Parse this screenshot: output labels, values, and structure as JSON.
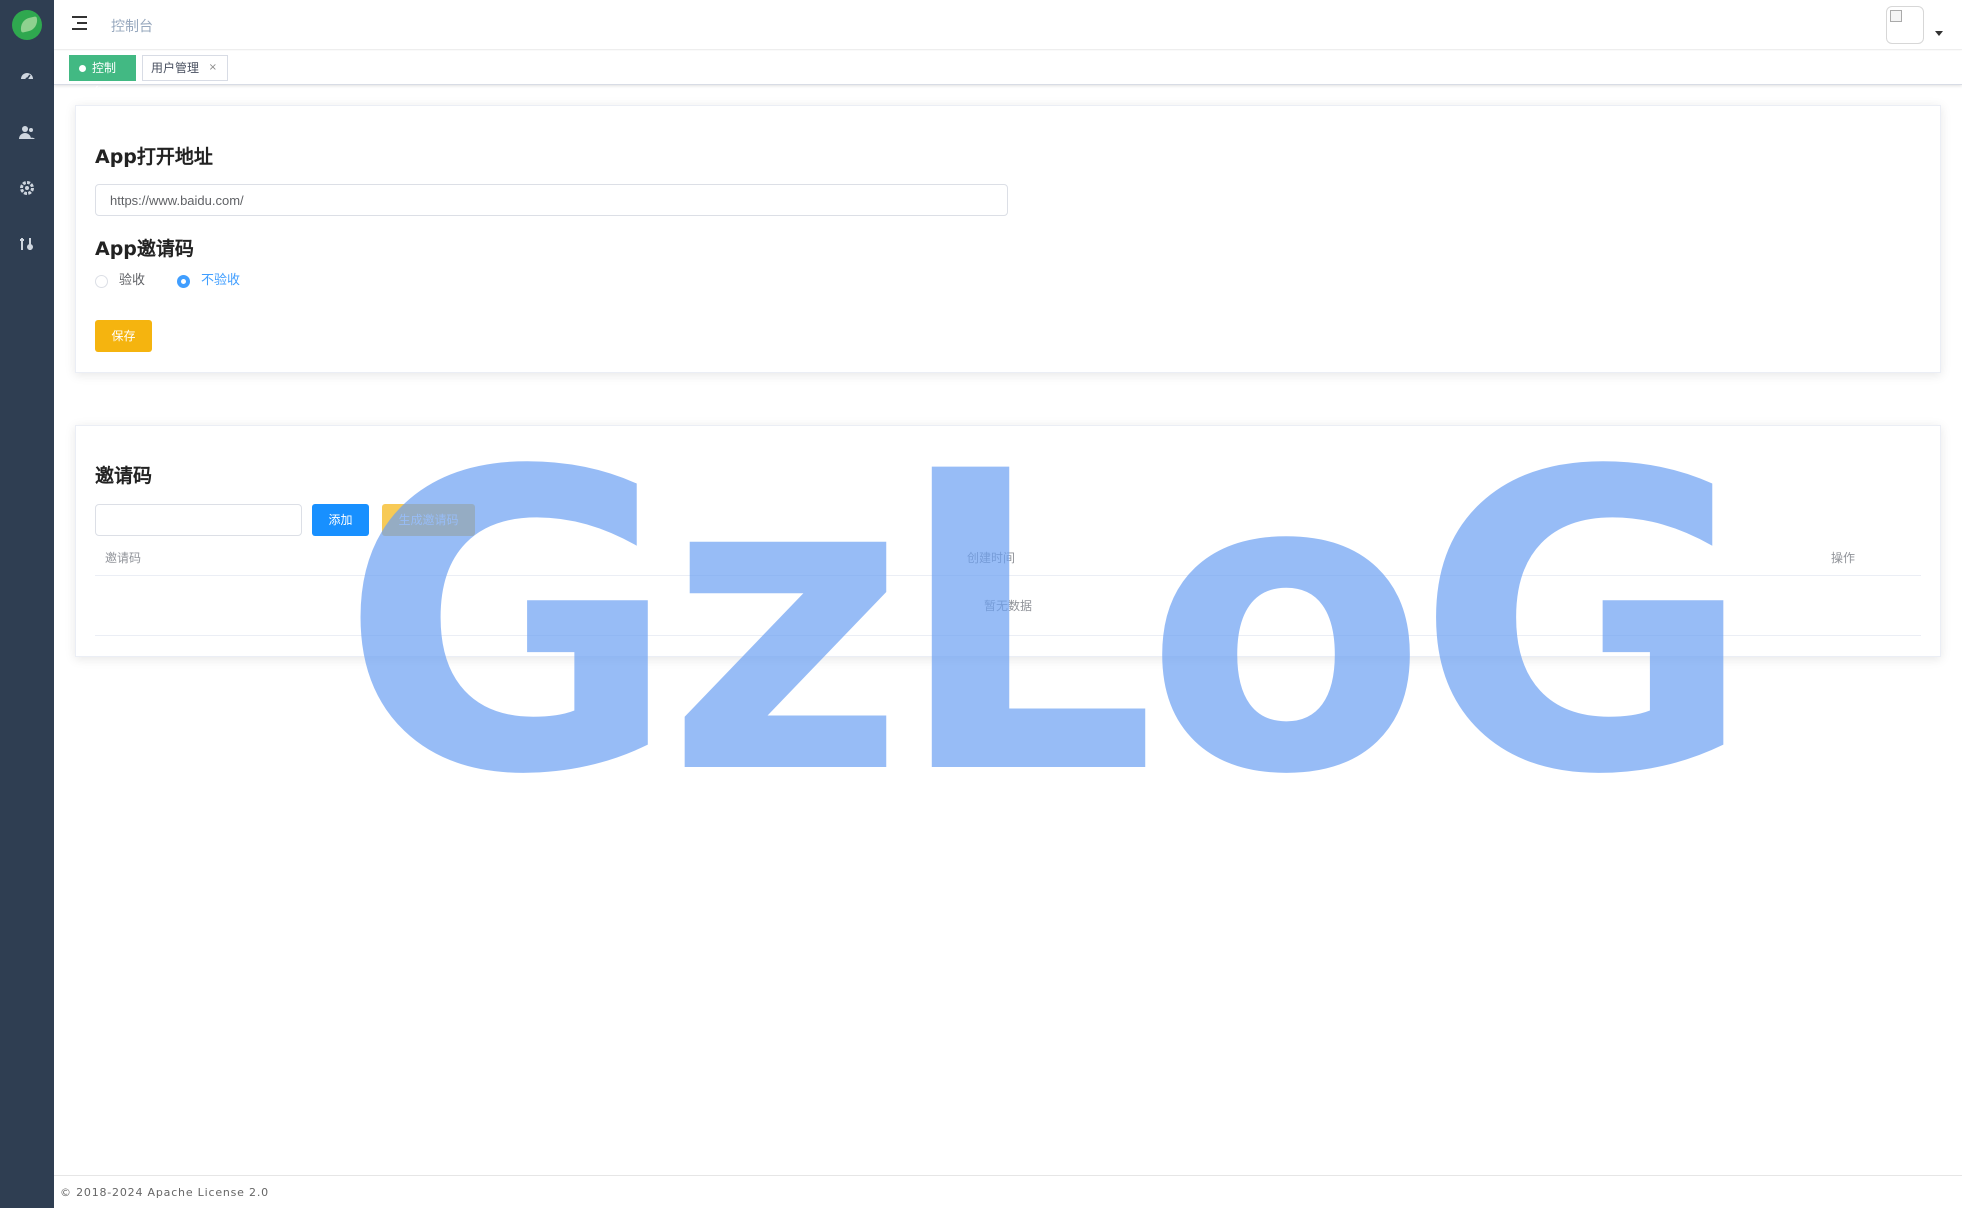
{
  "sidebar": {
    "icons": [
      "logo-leaf",
      "dashboard-icon",
      "users-icon",
      "settings-icon",
      "tools-icon"
    ]
  },
  "topbar": {
    "breadcrumb": "控制台"
  },
  "tags": {
    "active": "控制台",
    "items": [
      {
        "label": "用户管理"
      }
    ]
  },
  "settings": {
    "url_title": "App打开地址",
    "url_value": "https://www.baidu.com/",
    "invite_title": "App邀请码",
    "radio_options": [
      {
        "label": "验收",
        "checked": false
      },
      {
        "label": "不验收",
        "checked": true
      }
    ],
    "save_label": "保存"
  },
  "invite": {
    "title": "邀请码",
    "input_value": "",
    "add_label": "添加",
    "generate_label": "生成邀请码",
    "columns": [
      "邀请码",
      "创建时间",
      "操作"
    ],
    "empty_text": "暂无数据"
  },
  "watermark": "GzLoG",
  "footer": {
    "text": "© 2018-2024 Apache License 2.0"
  },
  "colors": {
    "sidebar": "#2f3e52",
    "active_tag": "#42b983",
    "primary": "#1890ff",
    "warning": "#f5b40f",
    "radio_checked": "#409eff",
    "watermark": "#6ba0f2"
  }
}
